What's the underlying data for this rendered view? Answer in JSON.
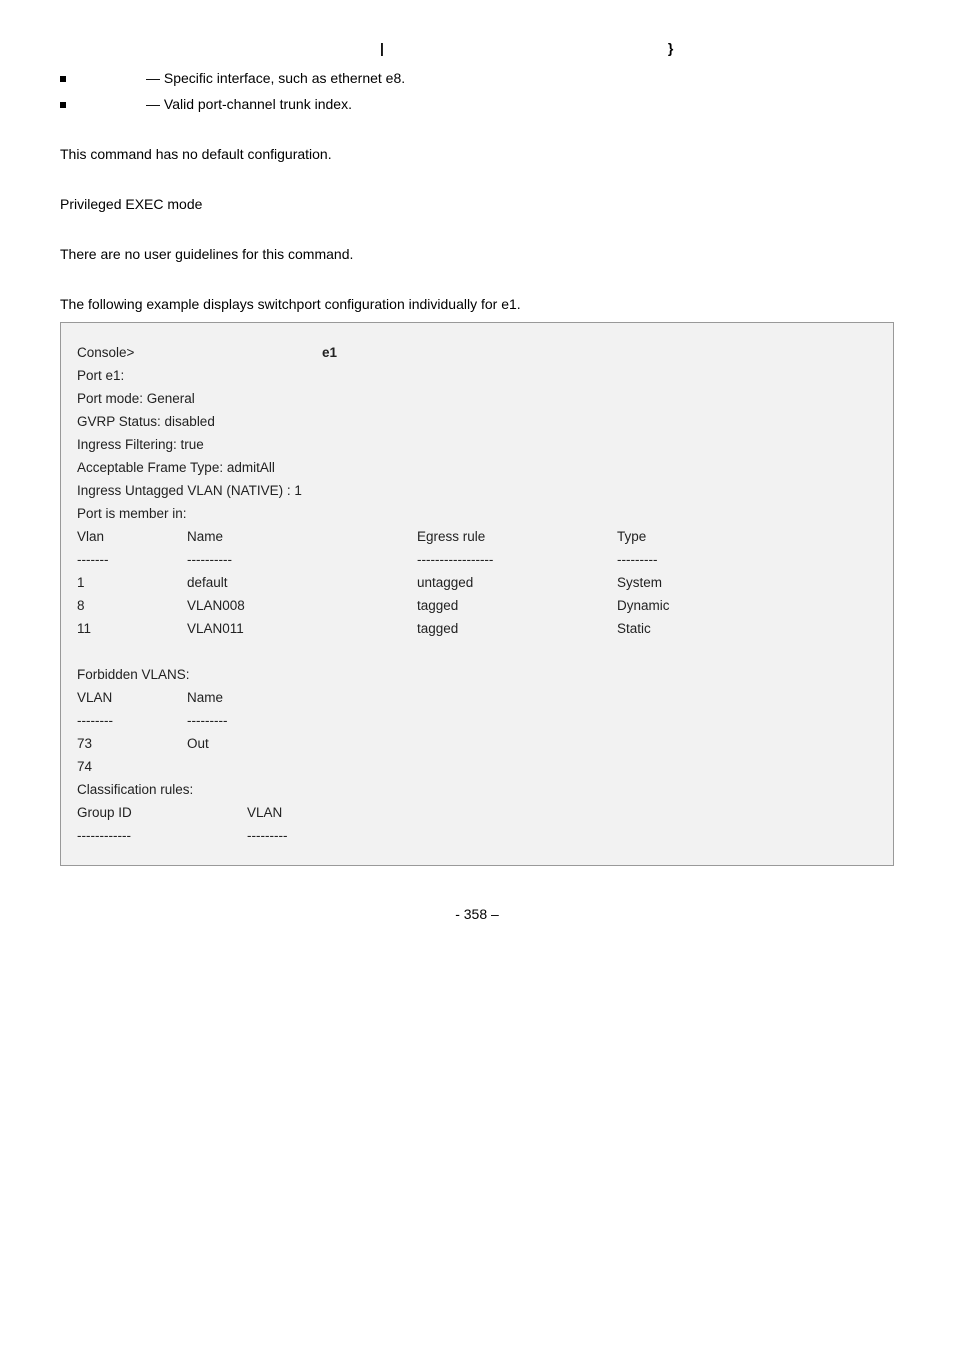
{
  "syntax": {
    "pipe": "|",
    "brace": "}"
  },
  "bullets": [
    {
      "text": " — Specific interface, such as ethernet e8."
    },
    {
      "text": " — Valid port-channel trunk index."
    }
  ],
  "default_cfg": "This command has no default configuration.",
  "mode": "Privileged EXEC mode",
  "guidelines": "There are no user guidelines for this command.",
  "example_intro": "The following example displays switchport configuration individually for e1.",
  "example": {
    "prompt": "Console>",
    "cmd_arg": "e1",
    "lines": [
      "Port e1:",
      "Port mode: General",
      "GVRP Status: disabled",
      "Ingress Filtering: true",
      "Acceptable Frame Type: admitAll",
      "Ingress Untagged VLAN (NATIVE) : 1",
      "Port is member in:"
    ],
    "table_head": {
      "c1": "Vlan",
      "c2": "Name",
      "c3": "Egress rule",
      "c4": "Type"
    },
    "table_sep": {
      "c1": "-------",
      "c2": "----------",
      "c3": "-----------------",
      "c4": "---------"
    },
    "rows": [
      {
        "c1": "1",
        "c2": "default",
        "c3": "untagged",
        "c4": "System"
      },
      {
        "c1": "8",
        "c2": "VLAN008",
        "c3": "tagged",
        "c4": "Dynamic"
      },
      {
        "c1": "11",
        "c2": "VLAN011",
        "c3": "tagged",
        "c4": "Static"
      }
    ],
    "forbidden_title": "Forbidden VLANS:",
    "fhead": {
      "c1": "VLAN",
      "c2": "Name"
    },
    "fsep": {
      "c1": "--------",
      "c2": "---------"
    },
    "frows": [
      {
        "c1": "73",
        "c2": "Out"
      },
      {
        "c1": "74",
        "c2": ""
      }
    ],
    "class_title": "Classification rules:",
    "ghead": {
      "c1": "Group ID",
      "c2": "VLAN"
    },
    "gsep": {
      "c1": "------------",
      "c2": "---------"
    }
  },
  "pagenum": "- 358 –"
}
